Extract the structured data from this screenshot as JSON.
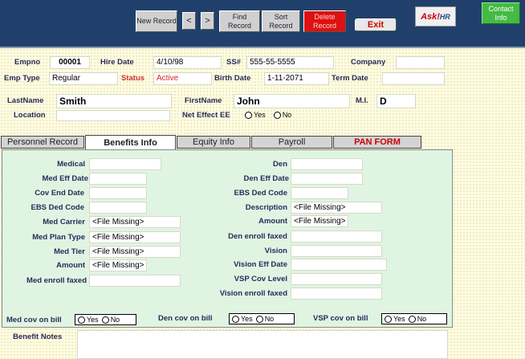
{
  "toolbar": {
    "new_record": "New Record",
    "prev": "<",
    "next": ">",
    "find_record": "Find Record",
    "sort_record": "Sort Record",
    "delete_record": "Delete Record",
    "exit": "Exit",
    "logo_ask": "Ask!",
    "logo_hr": "HR",
    "contact_info": "Contact Info"
  },
  "header": {
    "empno_label": "Empno",
    "empno": "00001",
    "hire_date_label": "Hire Date",
    "hire_date": "4/10/98",
    "ssn_label": "SS#",
    "ssn": "555-55-5555",
    "company_label": "Company",
    "company": "",
    "emp_type_label": "Emp Type",
    "emp_type": "Regular",
    "status_label": "Status",
    "status": "Active",
    "birth_date_label": "Birth Date",
    "birth_date": "1-11-2071",
    "term_date_label": "Term Date",
    "term_date": "",
    "last_name_label": "LastName",
    "last_name": "Smith",
    "first_name_label": "FirstName",
    "first_name": "John",
    "mi_label": "M.I.",
    "mi": "D",
    "location_label": "Location",
    "location": "",
    "net_effect_label": "Net Effect EE",
    "yes": "Yes",
    "no": "No"
  },
  "tabs": [
    "Personnel Record",
    "Benefits Info",
    "Equity Info",
    "Payroll",
    "PAN FORM"
  ],
  "left_fields": [
    {
      "label": "Medical",
      "value": ""
    },
    {
      "label": "Med Eff Date",
      "value": ""
    },
    {
      "label": "Cov End Date",
      "value": ""
    },
    {
      "label": "EBS Ded Code",
      "value": ""
    },
    {
      "label": "Med Carrier",
      "value": "<File Missing>"
    },
    {
      "label": "Med Plan Type",
      "value": "<File Missing>"
    },
    {
      "label": "Med Tier",
      "value": "<File Missing>"
    },
    {
      "label": "Amount",
      "value": "<File Missing>"
    },
    {
      "label": "Med enroll faxed",
      "value": ""
    }
  ],
  "right_fields": [
    {
      "label": "Den",
      "value": ""
    },
    {
      "label": "Den Eff Date",
      "value": ""
    },
    {
      "label": "EBS Ded Code",
      "value": ""
    },
    {
      "label": "Description",
      "value": "<File Missing>"
    },
    {
      "label": "Amount",
      "value": "<File Missing>"
    },
    {
      "label": "Den enroll faxed",
      "value": ""
    },
    {
      "label": "Vision",
      "value": ""
    },
    {
      "label": "Vision Eff Date",
      "value": ""
    },
    {
      "label": "VSP Cov Level",
      "value": ""
    },
    {
      "label": "Vision enroll faxed",
      "value": ""
    }
  ],
  "bill": {
    "med_label": "Med cov on bill",
    "den_label": "Den cov on bill",
    "vsp_label": "VSP cov on bill",
    "yes": "Yes",
    "no": "No"
  },
  "notes": {
    "label": "Benefit Notes",
    "value": ""
  }
}
